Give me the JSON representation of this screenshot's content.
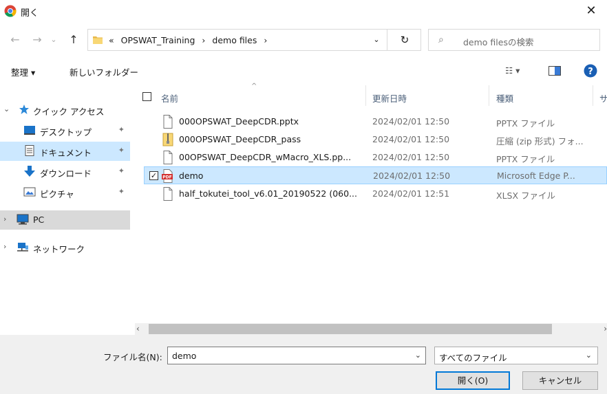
{
  "window": {
    "title": "開く",
    "close_glyph": "✕"
  },
  "nav": {
    "back_glyph": "←",
    "forward_glyph": "→",
    "recent_glyph": "⌄",
    "up_glyph": "↑",
    "breadcrumb": [
      "«",
      "OPSWAT_Training",
      "›",
      "demo files",
      "›"
    ],
    "address_dropdown_glyph": "⌄",
    "refresh_glyph": "↻",
    "search_placeholder": "demo filesの検索",
    "search_glyph": "⌕"
  },
  "toolbar": {
    "organize_label": "整理 ▾",
    "new_folder_label": "新しいフォルダー",
    "view_glyph": "☷ ▾",
    "help_glyph": "?"
  },
  "sidebar": {
    "items": [
      {
        "label": "クイック アクセス",
        "chevron": "⌄",
        "pin": ""
      },
      {
        "label": "デスクトップ",
        "chevron": "",
        "pin": "✦"
      },
      {
        "label": "ドキュメント",
        "chevron": "",
        "pin": "✦"
      },
      {
        "label": "ダウンロード",
        "chevron": "",
        "pin": "✦"
      },
      {
        "label": "ピクチャ",
        "chevron": "",
        "pin": "✦"
      },
      {
        "label": "PC",
        "chevron": "›",
        "pin": ""
      },
      {
        "label": "ネットワーク",
        "chevron": "›",
        "pin": ""
      }
    ]
  },
  "table": {
    "headers": {
      "name": "名前",
      "date": "更新日時",
      "type": "種類",
      "size": "サ"
    },
    "sort_glyph": "^",
    "rows": [
      {
        "name": "000OPSWAT_DeepCDR.pptx",
        "date": "2024/02/01 12:50",
        "type": "PPTX ファイル",
        "checked": ""
      },
      {
        "name": "000OPSWAT_DeepCDR_pass",
        "date": "2024/02/01 12:50",
        "type": "圧縮 (zip 形式) フォ...",
        "checked": ""
      },
      {
        "name": "00OPSWAT_DeepCDR_wMacro_XLS.pp...",
        "date": "2024/02/01 12:50",
        "type": "PPTX ファイル",
        "checked": ""
      },
      {
        "name": "demo",
        "date": "2024/02/01 12:50",
        "type": "Microsoft Edge P...",
        "checked": "✓"
      },
      {
        "name": "half_tokutei_tool_v6.01_20190522 (060...",
        "date": "2024/02/01 12:51",
        "type": "XLSX ファイル",
        "checked": ""
      }
    ]
  },
  "scroll": {
    "left_glyph": "‹",
    "right_glyph": "›"
  },
  "bottom": {
    "filename_label": "ファイル名(N):",
    "filename_value": "demo",
    "filetype_value": "すべてのファイル",
    "dropdown_glyph": "⌄",
    "open_label": "開く(O)",
    "cancel_label": "キャンセル"
  },
  "colors": {
    "selection": "#cce8ff",
    "accent": "#0078d7",
    "folder": "#f8d775",
    "pdf": "#d32f2f"
  }
}
